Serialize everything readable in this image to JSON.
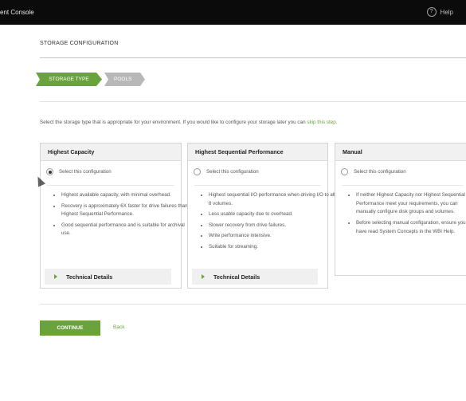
{
  "window": {
    "title": "ent Console",
    "help_label": "Help",
    "help_icon": "question-circle-icon"
  },
  "page": {
    "heading": "STORAGE CONFIGURATION"
  },
  "steps": [
    {
      "label": "STORAGE TYPE",
      "state": "active"
    },
    {
      "label": "POOLS",
      "state": "inactive"
    }
  ],
  "intro": {
    "text": "Select the storage type that is appropriate for your environment. If you would like to configure your storage later you can ",
    "link": "skip this step."
  },
  "options": [
    {
      "title": "Highest Capacity",
      "select_label": "Select this configuration",
      "selected": true,
      "bullets": [
        "Highest available capacity, with minimal overhead.",
        "Recovery is approximately 6X faster for drive failures than Highest Sequential Performance.",
        "Good sequential performance and is suitable for archival use."
      ],
      "details_label": "Technical Details"
    },
    {
      "title": "Highest Sequential Performance",
      "select_label": "Select this configuration",
      "selected": false,
      "bullets": [
        "Highest sequential I/O performance when driving I/O to all 8 volumes.",
        "Less usable capacity due to overhead.",
        "Slower recovery from drive failures.",
        "Write performance intensive.",
        "Suitable for streaming."
      ],
      "details_label": "Technical Details"
    },
    {
      "title": "Manual",
      "select_label": "Select this configuration",
      "selected": false,
      "bullets": [
        "If neither Highest Capacity nor Highest Sequential Performance meet your requirements, you can manually configure disk groups and volumes.",
        "Before selecting manual configuration, ensure you have read System Concepts in the WBI Help."
      ]
    }
  ],
  "actions": {
    "continue_label": "CONTINUE",
    "back_label": "Back"
  },
  "colors": {
    "accent": "#6aa33c",
    "topbar": "#0b0b0b",
    "inactive_step": "#b8b8b8"
  }
}
